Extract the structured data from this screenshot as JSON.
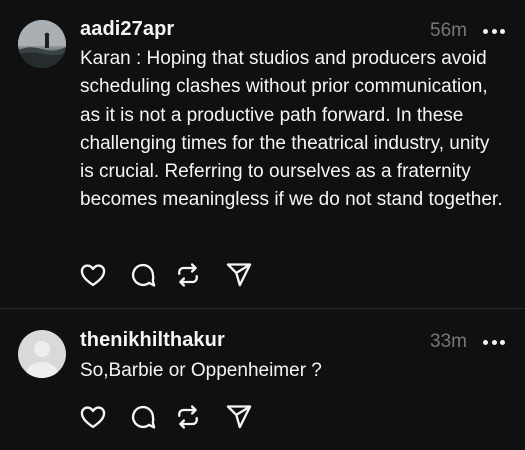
{
  "posts": [
    {
      "username": "aadi27apr",
      "time": "56m",
      "avatar": "profile-photo",
      "text": "Karan : Hoping that studios and producers avoid scheduling clashes without prior communication, as it is not a productive path forward. In these challenging times for the theatrical industry, unity is crucial. Referring to ourselves as a fraternity becomes meaningless if we do not stand together."
    },
    {
      "username": "thenikhilthakur",
      "time": "33m",
      "avatar": "default-avatar",
      "text": "So,Barbie or Oppenheimer ?"
    }
  ],
  "actions": [
    "heart-icon",
    "comment-icon",
    "repost-icon",
    "share-icon"
  ],
  "colors": {
    "background": "#101010",
    "text": "#f3f5f7",
    "muted": "#777777",
    "divider": "#2a2a2a"
  }
}
